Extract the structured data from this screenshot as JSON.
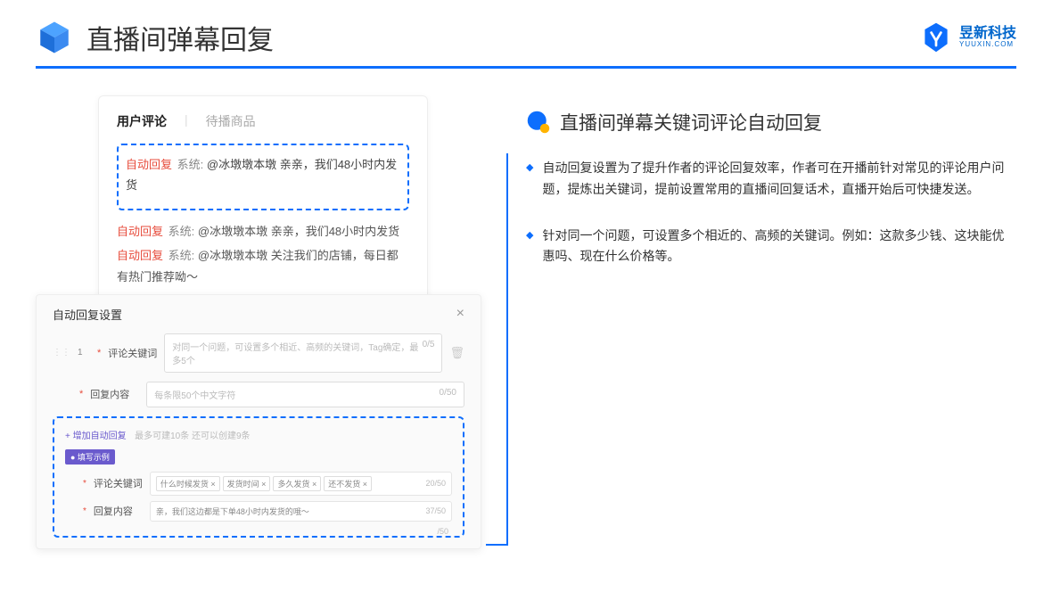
{
  "header": {
    "title": "直播间弹幕回复",
    "brand_name": "昱新科技",
    "brand_url": "YUUXIN.COM"
  },
  "comment_panel": {
    "tab_active": "用户评论",
    "tab_inactive": "待播商品",
    "auto_reply_label": "自动回复",
    "system_label": "系统:",
    "highlighted_msg": "@冰墩墩本墩 亲亲，我们48小时内发货",
    "msg2": "@冰墩墩本墩 亲亲，我们48小时内发货",
    "msg3": "@冰墩墩本墩 关注我们的店铺，每日都有热门推荐呦～"
  },
  "settings": {
    "title": "自动回复设置",
    "row_num": "1",
    "keyword_label": "评论关键词",
    "keyword_placeholder": "对同一个问题，可设置多个相近、高频的关键词，Tag确定，最多5个",
    "keyword_counter": "0/5",
    "content_label": "回复内容",
    "content_placeholder": "每条限50个中文字符",
    "content_counter": "0/50",
    "add_link": "+ 增加自动回复",
    "add_hint": "最多可建10条 还可以创建9条",
    "example_badge": "● 填写示例",
    "example_keyword_label": "评论关键词",
    "example_tags": [
      "什么时候发货 ×",
      "发货时间 ×",
      "多久发货 ×",
      "还不发货 ×"
    ],
    "example_keyword_counter": "20/50",
    "example_content_label": "回复内容",
    "example_content": "亲，我们这边都是下单48小时内发货的哦～",
    "example_content_counter": "37/50",
    "stray_counter": "/50"
  },
  "right": {
    "section_title": "直播间弹幕关键词评论自动回复",
    "bullet1": "自动回复设置为了提升作者的评论回复效率，作者可在开播前针对常见的评论用户问题，提炼出关键词，提前设置常用的直播间回复话术，直播开始后可快捷发送。",
    "bullet2": "针对同一个问题，可设置多个相近的、高频的关键词。例如：这款多少钱、这块能优惠吗、现在什么价格等。"
  }
}
